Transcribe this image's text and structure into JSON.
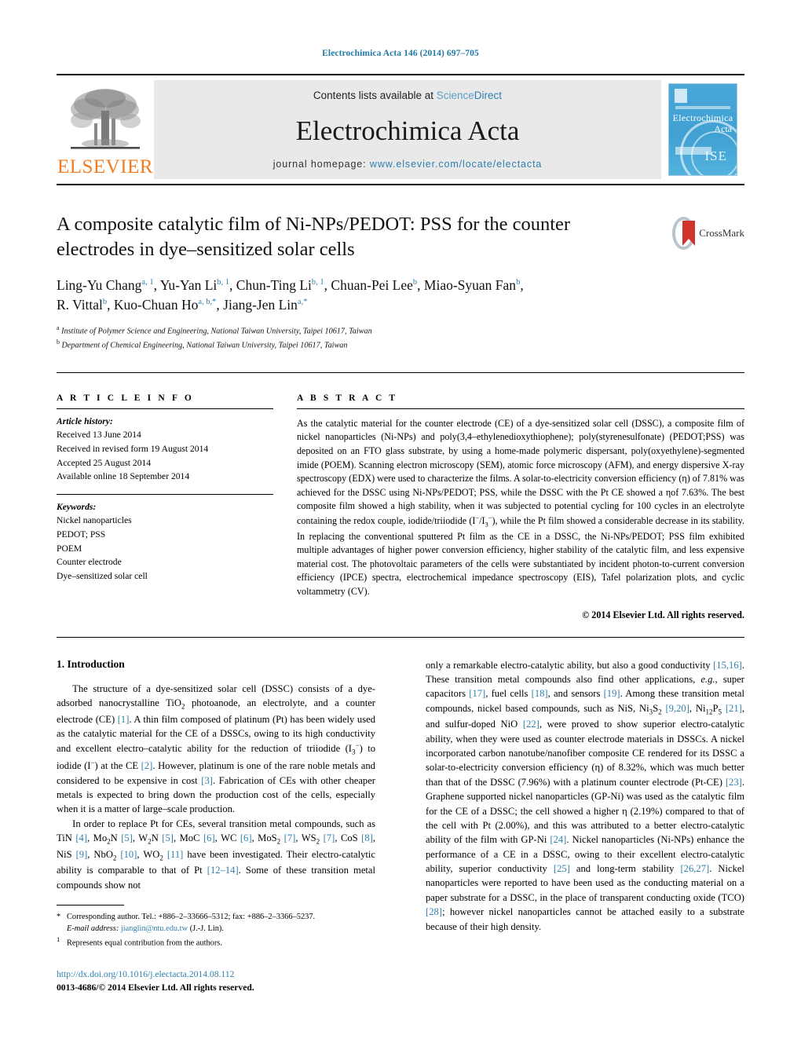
{
  "running_head": "Electrochimica Acta 146 (2014) 697–705",
  "masthead": {
    "publisher_name": "ELSEVIER",
    "contents_prefix": "Contents lists available at ",
    "contents_link_1": "Science",
    "contents_link_2": "Direct",
    "journal_title": "Electrochimica Acta",
    "homepage_label": "journal homepage:",
    "homepage_url": "www.elsevier.com/locate/electacta",
    "cover_line1": "Electrochimica",
    "cover_line2": "Acta",
    "cover_society": "ISE"
  },
  "article": {
    "title_line1": "A composite catalytic film of Ni-NPs/PEDOT: PSS for the counter",
    "title_line2": "electrodes in dye–sensitized solar cells",
    "crossmark_label": "CrossMark",
    "authors_line1_parts": [
      {
        "name": "Ling-Yu Chang",
        "sup": "a, 1"
      },
      {
        "name": "Yu-Yan Li",
        "sup": "b, 1"
      },
      {
        "name": "Chun-Ting Li",
        "sup": "b, 1"
      },
      {
        "name": "Chuan-Pei Lee",
        "sup": "b"
      },
      {
        "name": "Miao-Syuan Fan",
        "sup": "b"
      }
    ],
    "authors_line2_parts": [
      {
        "name": "R. Vittal",
        "sup": "b"
      },
      {
        "name": "Kuo-Chuan Ho",
        "sup": "a, b,*"
      },
      {
        "name": "Jiang-Jen Lin",
        "sup": "a,*"
      }
    ],
    "affiliation_a_sup": "a",
    "affiliation_a": "Institute of Polymer Science and Engineering, National Taiwan University, Taipei 10617, Taiwan",
    "affiliation_b_sup": "b",
    "affiliation_b": "Department of Chemical Engineering, National Taiwan University, Taipei 10617, Taiwan"
  },
  "article_info": {
    "heading": "A R T I C L E   I N F O",
    "history_label": "Article history:",
    "history": [
      "Received 13 June 2014",
      "Received in revised form 19 August 2014",
      "Accepted 25 August 2014",
      "Available online 18 September 2014"
    ],
    "keywords_label": "Keywords:",
    "keywords": [
      "Nickel nanoparticles",
      "PEDOT; PSS",
      "POEM",
      "Counter electrode",
      "Dye–sensitized solar cell"
    ]
  },
  "abstract": {
    "heading": "A B S T R A C T",
    "text_p1": "As the catalytic material for the counter electrode (CE) of a dye-sensitized solar cell (DSSC), a composite film of nickel nanoparticles (Ni-NPs) and poly(3,4–ethylenedioxythiophene); poly(styrenesulfonate) (PEDOT;PSS) was deposited on an FTO glass substrate, by using a home-made polymeric dispersant, poly(oxyethylene)-segmented imide (POEM). Scanning electron microscopy (SEM), atomic force microscopy (AFM), and energy dispersive X-ray spectroscopy (EDX) were used to characterize the films. A solar-to-electricity conversion efficiency (η) of 7.81% was achieved for the DSSC using Ni-NPs/PEDOT; PSS, while the DSSC with the Pt CE showed a ηof 7.63%. The best composite film showed a high stability, when it was subjected to potential cycling for 100 cycles in an electrolyte containing the redox couple, iodide/triiodide (I",
    "text_p1_sup1": "−",
    "text_p1_mid": "/I",
    "text_p1_sub1": "3",
    "text_p1_sup2": "−",
    "text_p2": "), while the Pt film showed a considerable decrease in its stability. In replacing the conventional sputtered Pt film as the CE in a DSSC, the Ni-NPs/PEDOT; PSS film exhibited multiple advantages of higher power conversion efficiency, higher stability of the catalytic film, and less expensive material cost. The photovoltaic parameters of the cells were substantiated by incident photon-to-current conversion efficiency (IPCE) spectra, electrochemical impedance spectroscopy (EIS), Tafel polarization plots, and cyclic voltammetry (CV).",
    "copyright": "© 2014 Elsevier Ltd. All rights reserved."
  },
  "section": {
    "number_title": "1.  Introduction"
  },
  "body": {
    "left_p1_a": "The structure of a dye-sensitized solar cell (DSSC) consists of a dye-adsorbed nanocrystalline TiO",
    "left_p1_sub": "2",
    "left_p1_b": " photoanode, an electrolyte, and a counter electrode (CE) ",
    "left_p1_r1": "[1]",
    "left_p1_c": ". A thin film composed of platinum (Pt) has been widely used as the catalytic material for the CE of a DSSCs, owing to its high conductivity and excellent electro–catalytic ability for the reduction of triiodide (I",
    "left_p1_sub2": "3",
    "left_p1_sup2": "−",
    "left_p1_d": ") to iodide (I",
    "left_p1_sup3": "−",
    "left_p1_e": ") at the CE ",
    "left_p1_r2": "[2]",
    "left_p1_f": ". However, platinum is one of the rare noble metals and considered to be expensive in cost ",
    "left_p1_r3": "[3]",
    "left_p1_g": ". Fabrication of CEs with other cheaper metals is expected to bring down the production cost of the cells, especially when it is a matter of large–scale production.",
    "left_p2_a": "In order to replace Pt for CEs, several transition metal compounds, such as TiN ",
    "left_p2_r4": "[4]",
    "left_p2_b": ", Mo",
    "left_p2_sub_2a": "2",
    "left_p2_c": "N ",
    "left_p2_r5": "[5]",
    "left_p2_d": ", W",
    "left_p2_sub_2b": "2",
    "left_p2_e": "N ",
    "left_p2_r5b": "[5]",
    "left_p2_f": ", MoC ",
    "left_p2_r6": "[6]",
    "left_p2_g": ", WC ",
    "left_p2_r6b": "[6]",
    "left_p2_h": ", MoS",
    "left_p2_sub_2c": "2",
    "left_p2_i": " ",
    "left_p2_r7": "[7]",
    "left_p2_j": ", WS",
    "left_p2_sub_2d": "2",
    "left_p2_k": " ",
    "left_p2_r7b": "[7]",
    "left_p2_l": ", CoS ",
    "left_p2_r8": "[8]",
    "left_p2_m": ", NiS ",
    "left_p2_r9": "[9]",
    "left_p2_n": ", NbO",
    "left_p2_sub_2e": "2",
    "left_p2_o": " ",
    "left_p2_r10": "[10]",
    "left_p2_p": ", WO",
    "left_p2_sub_2f": "2",
    "left_p2_q": " ",
    "left_p2_r11": "[11]",
    "left_p2_r": " have been investigated. Their electro-catalytic ability is comparable to that of Pt ",
    "left_p2_r12": "[12–14]",
    "left_p2_s": ". Some of these transition metal compounds show not",
    "right_p1_a": "only a remarkable electro-catalytic ability, but also a good conductivity ",
    "right_p1_r1516": "[15,16]",
    "right_p1_b": ". These transition metal compounds also find other applications, ",
    "right_p1_eg": "e.g.,",
    "right_p1_c": " super capacitors ",
    "right_p1_r17": "[17]",
    "right_p1_d": ", fuel cells ",
    "right_p1_r18": "[18]",
    "right_p1_e": ", and sensors ",
    "right_p1_r19": "[19]",
    "right_p1_f": ". Among these transition metal compounds, nickel based compounds, such as NiS, Ni",
    "right_p1_sub3": "3",
    "right_p1_g": "S",
    "right_p1_sub2": "2",
    "right_p1_h": " ",
    "right_p1_r920": "[9,20]",
    "right_p1_i": ", Ni",
    "right_p1_sub12": "12",
    "right_p1_j": "P",
    "right_p1_sub5": "5",
    "right_p1_k": " ",
    "right_p1_r21": "[21]",
    "right_p1_l": ", and sulfur-doped NiO ",
    "right_p1_r22": "[22]",
    "right_p1_m": ", were proved to show superior electro-catalytic ability, when they were used as counter electrode materials in DSSCs. A nickel incorporated carbon nanotube/nanofiber composite CE rendered for its DSSC a solar-to-electricity conversion efficiency (η) of 8.32%, which was much better than that of the DSSC (7.96%) with a platinum counter electrode (Pt-CE) ",
    "right_p1_r23": "[23]",
    "right_p1_n": ". Graphene supported nickel nanoparticles (GP-Ni) was used as the catalytic film for the CE of a DSSC; the cell showed a higher η (2.19%) compared to that of the cell with Pt (2.00%), and this was attributed to a better electro-catalytic ability of the film with GP-Ni ",
    "right_p1_r24": "[24]",
    "right_p1_o": ". Nickel nanoparticles (Ni-NPs) enhance the performance of a CE in a DSSC, owing to their excellent electro-catalytic ability, superior conductivity ",
    "right_p1_r25": "[25]",
    "right_p1_p": " and long-term stability ",
    "right_p1_r2627": "[26,27]",
    "right_p1_q": ". Nickel nanoparticles were reported to have been used as the conducting material on a paper substrate for a DSSC, in the place of transparent conducting oxide (TCO) ",
    "right_p1_r28": "[28]",
    "right_p1_r": "; however nickel nanoparticles cannot be attached easily to a substrate because of their high density."
  },
  "footnotes": {
    "star_marker": "*",
    "star_text": "Corresponding author. Tel.: +886–2–33666–5312; fax: +886–2–3366–5237.",
    "email_label": "E-mail address:",
    "email": "jianglin@ntu.edu.tw",
    "email_suffix": "(J.-J. Lin).",
    "one_marker": "1",
    "one_text": "Represents equal contribution from the authors."
  },
  "footer": {
    "doi": "http://dx.doi.org/10.1016/j.electacta.2014.08.112",
    "issn": "0013-4686/© 2014 Elsevier Ltd. All rights reserved."
  },
  "colors": {
    "link": "#2f7faе",
    "elsevier_orange": "#F47B20",
    "cover_blue": "#46a6d6"
  }
}
